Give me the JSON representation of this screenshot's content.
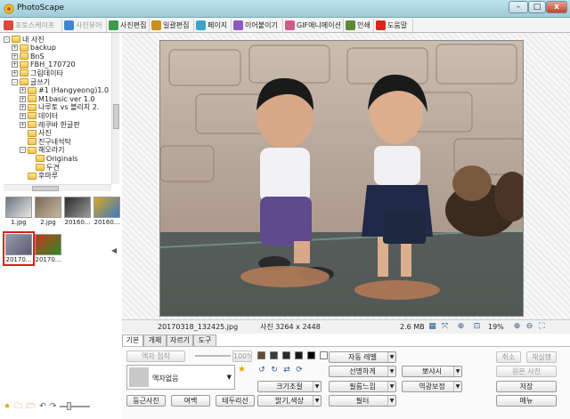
{
  "window": {
    "title": "PhotoScape",
    "min": "–",
    "max": "□",
    "close": "x"
  },
  "tabs": [
    {
      "label": "포토스케이프",
      "color": "#d8483c",
      "disabled": true
    },
    {
      "label": "사진뷰어",
      "color": "#3f86d0",
      "disabled": true
    },
    {
      "label": "사진편집",
      "color": "#3a9a48",
      "disabled": false
    },
    {
      "label": "일괄편집",
      "color": "#c8901e",
      "disabled": false
    },
    {
      "label": "페이지",
      "color": "#3fa3c8",
      "disabled": false
    },
    {
      "label": "이어붙이기",
      "color": "#8b5cc0",
      "disabled": false
    },
    {
      "label": "GIF애니메이션",
      "color": "#d05a8a",
      "disabled": false
    },
    {
      "label": "인쇄",
      "color": "#5a8a3a",
      "disabled": false
    },
    {
      "label": "도움말",
      "color": "#d8281c",
      "disabled": false
    }
  ],
  "tree": [
    {
      "label": "내 사진",
      "exp": "-",
      "indent": 0
    },
    {
      "label": "backup",
      "exp": "+",
      "indent": 1
    },
    {
      "label": "BnS",
      "exp": "+",
      "indent": 1
    },
    {
      "label": "FBH_170720",
      "exp": "+",
      "indent": 1
    },
    {
      "label": "그림데이타",
      "exp": "+",
      "indent": 1
    },
    {
      "label": "글쓰기",
      "exp": "-",
      "indent": 1
    },
    {
      "label": "#1 (Hangyeong)1.0",
      "exp": "+",
      "indent": 2
    },
    {
      "label": "M1basic ver 1.0",
      "exp": "+",
      "indent": 2
    },
    {
      "label": "나루토 vs 블리치 2.",
      "exp": "+",
      "indent": 2
    },
    {
      "label": "데이터",
      "exp": "+",
      "indent": 2
    },
    {
      "label": "레쿠바 한글판",
      "exp": "+",
      "indent": 2
    },
    {
      "label": "사진",
      "exp": "",
      "indent": 2
    },
    {
      "label": "진구네석탁",
      "exp": "",
      "indent": 2
    },
    {
      "label": "해오라기",
      "exp": "-",
      "indent": 2
    },
    {
      "label": "Originals",
      "exp": "",
      "indent": 3
    },
    {
      "label": "두견",
      "exp": "",
      "indent": 3
    },
    {
      "label": "후마루",
      "exp": "",
      "indent": 2
    }
  ],
  "thumbnails": [
    {
      "caption": "1.jpg",
      "colors": [
        "#6a7585",
        "#e8e8e0"
      ]
    },
    {
      "caption": "2.jpg",
      "colors": [
        "#7b6a58",
        "#c8b8a0"
      ]
    },
    {
      "caption": "20160...",
      "colors": [
        "#2b2b2b",
        "#9a9a9a"
      ]
    },
    {
      "caption": "20160...",
      "colors": [
        "#d8a820",
        "#3a78c8"
      ]
    },
    {
      "caption": "20170...",
      "colors": [
        "#9a9aa8",
        "#5a5a78"
      ],
      "selected": true
    },
    {
      "caption": "20170...",
      "colors": [
        "#c83818",
        "#2a8a28"
      ]
    }
  ],
  "status": {
    "filename": "20170318_132425.jpg",
    "dimensions": "사진 3264 x 2448",
    "filesize": "2.6 MB",
    "zoom": "19%"
  },
  "edit_tabs": [
    "기본",
    "개체",
    "자르기",
    "도구"
  ],
  "edit": {
    "frame_merge": "액자 접착",
    "frame_percent": "100%",
    "frame_name": "액자없음",
    "round_photo": "둥근사진",
    "margin": "여백",
    "border": "테두리선",
    "auto_level": "자동 레벨",
    "sharpen": "선명하게",
    "resize": "크기조절",
    "film": "필름느낌",
    "brightness_color": "밝기,색상",
    "filter": "필터",
    "soften": "뽀샤시",
    "backlight": "역광보정",
    "undo": "취소",
    "redo": "재실행",
    "original": "원본 사진",
    "save": "저장",
    "menu": "메뉴"
  },
  "swatches": [
    "#6b4a2a",
    "#3a3a3a",
    "#2a2a2a",
    "#1a1a1a",
    "#000000",
    "#ffffff"
  ]
}
